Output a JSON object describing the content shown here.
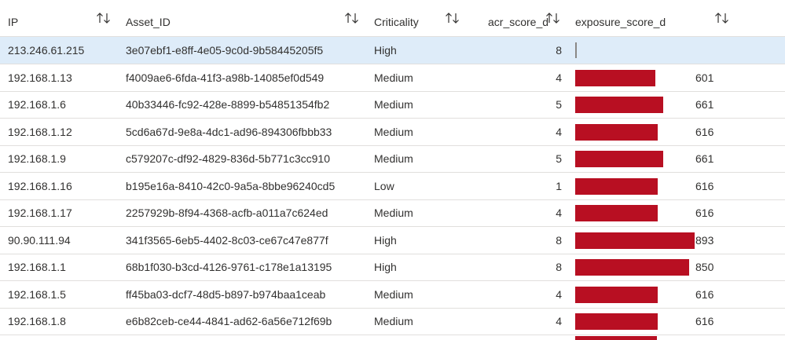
{
  "columns": [
    {
      "key": "ip",
      "label": "IP"
    },
    {
      "key": "asset_id",
      "label": "Asset_ID"
    },
    {
      "key": "criticality",
      "label": "Criticality"
    },
    {
      "key": "acr",
      "label": "acr_score_d"
    },
    {
      "key": "exposure",
      "label": "exposure_score_d"
    }
  ],
  "exposure_max": 1000,
  "colors": {
    "bar": "#b80f22",
    "selected_row": "#deecf9",
    "row_border": "#e1dfdd"
  },
  "icons": {
    "sort": "sort-up-down-icon"
  },
  "rows": [
    {
      "ip": "213.246.61.215",
      "asset_id": "3e07ebf1-e8ff-4e05-9c0d-9b58445205f5",
      "criticality": "High",
      "acr": "8",
      "exposure": "",
      "exposure_value": 0,
      "selected": true
    },
    {
      "ip": "192.168.1.13",
      "asset_id": "f4009ae6-6fda-41f3-a98b-14085ef0d549",
      "criticality": "Medium",
      "acr": "4",
      "exposure": "601",
      "exposure_value": 601
    },
    {
      "ip": "192.168.1.6",
      "asset_id": "40b33446-fc92-428e-8899-b54851354fb2",
      "criticality": "Medium",
      "acr": "5",
      "exposure": "661",
      "exposure_value": 661
    },
    {
      "ip": "192.168.1.12",
      "asset_id": "5cd6a67d-9e8a-4dc1-ad96-894306fbbb33",
      "criticality": "Medium",
      "acr": "4",
      "exposure": "616",
      "exposure_value": 616
    },
    {
      "ip": "192.168.1.9",
      "asset_id": "c579207c-df92-4829-836d-5b771c3cc910",
      "criticality": "Medium",
      "acr": "5",
      "exposure": "661",
      "exposure_value": 661
    },
    {
      "ip": "192.168.1.16",
      "asset_id": "b195e16a-8410-42c0-9a5a-8bbe96240cd5",
      "criticality": "Low",
      "acr": "1",
      "exposure": "616",
      "exposure_value": 616
    },
    {
      "ip": "192.168.1.17",
      "asset_id": "2257929b-8f94-4368-acfb-a011a7c624ed",
      "criticality": "Medium",
      "acr": "4",
      "exposure": "616",
      "exposure_value": 616
    },
    {
      "ip": "90.90.111.94",
      "asset_id": "341f3565-6eb5-4402-8c03-ce67c47e877f",
      "criticality": "High",
      "acr": "8",
      "exposure": "893",
      "exposure_value": 893
    },
    {
      "ip": "192.168.1.1",
      "asset_id": "68b1f030-b3cd-4126-9761-c178e1a13195",
      "criticality": "High",
      "acr": "8",
      "exposure": "850",
      "exposure_value": 850
    },
    {
      "ip": "192.168.1.5",
      "asset_id": "ff45ba03-dcf7-48d5-b897-b974baa1ceab",
      "criticality": "Medium",
      "acr": "4",
      "exposure": "616",
      "exposure_value": 616
    },
    {
      "ip": "192.168.1.8",
      "asset_id": "e6b82ceb-ce44-4841-ad62-6a56e712f69b",
      "criticality": "Medium",
      "acr": "4",
      "exposure": "616",
      "exposure_value": 616
    }
  ]
}
